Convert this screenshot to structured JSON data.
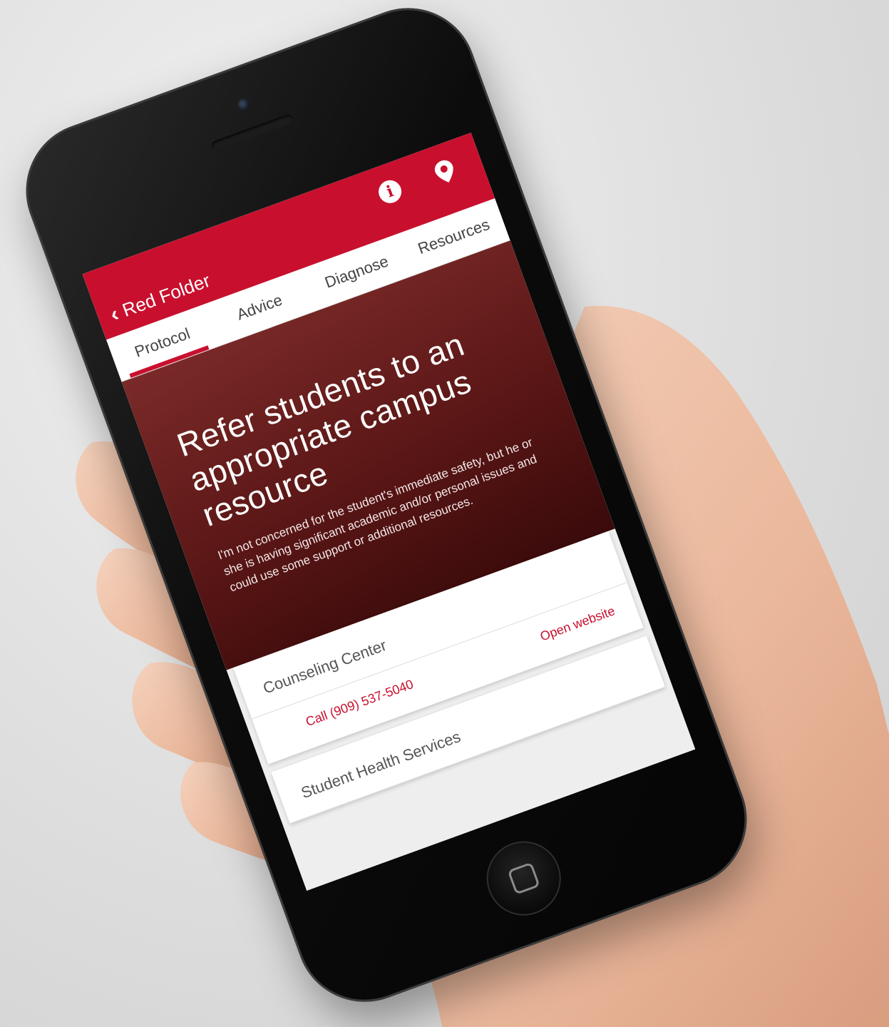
{
  "app": {
    "back_label": "Red Folder",
    "accent_color": "#c8102e",
    "icons": [
      "chevron-left-icon",
      "info-icon",
      "location-pin-icon"
    ]
  },
  "tabs": [
    {
      "label": "Protocol",
      "active": true
    },
    {
      "label": "Advice",
      "active": false
    },
    {
      "label": "Diagnose",
      "active": false
    },
    {
      "label": "Resources",
      "active": false
    }
  ],
  "hero": {
    "title": "Refer students to an appropriate campus resource",
    "description": "I'm not concerned for the student's immediate safety, but he or she is having significant academic and/or personal issues and could use some support or additional resources."
  },
  "resources": [
    {
      "name": "Counseling Center",
      "call_label": "Call (909) 537-5040",
      "website_label": "Open website"
    },
    {
      "name": "Student Health Services"
    }
  ]
}
